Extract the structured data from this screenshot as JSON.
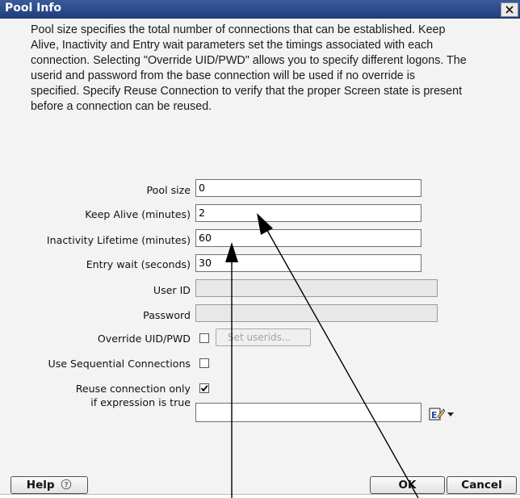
{
  "window": {
    "title": "Pool Info"
  },
  "description": {
    "lines": [
      "Pool size specifies the total number of connections that can be established.  Keep",
      "Alive, Inactivity and Entry wait parameters set the timings associated with each",
      "connection.  Selecting \"Override UID/PWD\" allows you to specify different logons. The",
      "userid and password from the base connection will be used if no override is",
      "specified. Specify Reuse Connection to verify that the proper Screen state is present",
      "before a connection can be reused."
    ]
  },
  "form": {
    "pool_size_label": "Pool size",
    "pool_size_value": "0",
    "keep_alive_label": "Keep Alive (minutes)",
    "keep_alive_value": "2",
    "inactivity_label": "Inactivity Lifetime (minutes)",
    "inactivity_value": "60",
    "entry_wait_label": "Entry wait (seconds)",
    "entry_wait_value": "30",
    "user_id_label": "User ID",
    "user_id_value": "",
    "password_label": "Password",
    "password_value": "",
    "override_label": "Override UID/PWD",
    "override_checked": false,
    "set_userids_label": "Set userids...",
    "sequential_label": "Use Sequential Connections",
    "sequential_checked": false,
    "reuse_label_line1": "Reuse connection only",
    "reuse_label_line2": "if expression is true",
    "reuse_checked": true,
    "expression_value": ""
  },
  "buttons": {
    "help_label": "Help",
    "ok_label": "OK",
    "cancel_label": "Cancel"
  },
  "icons": {
    "close": "close-icon",
    "help": "help-circle-icon",
    "expression_editor": "expression-editor-icon",
    "dropdown": "chevron-down-icon",
    "check": "check-icon"
  },
  "colors": {
    "titlebar": "#1f3f7e",
    "dialog_background": "#f3f3f3",
    "disabled_field": "#e8e8e8"
  }
}
